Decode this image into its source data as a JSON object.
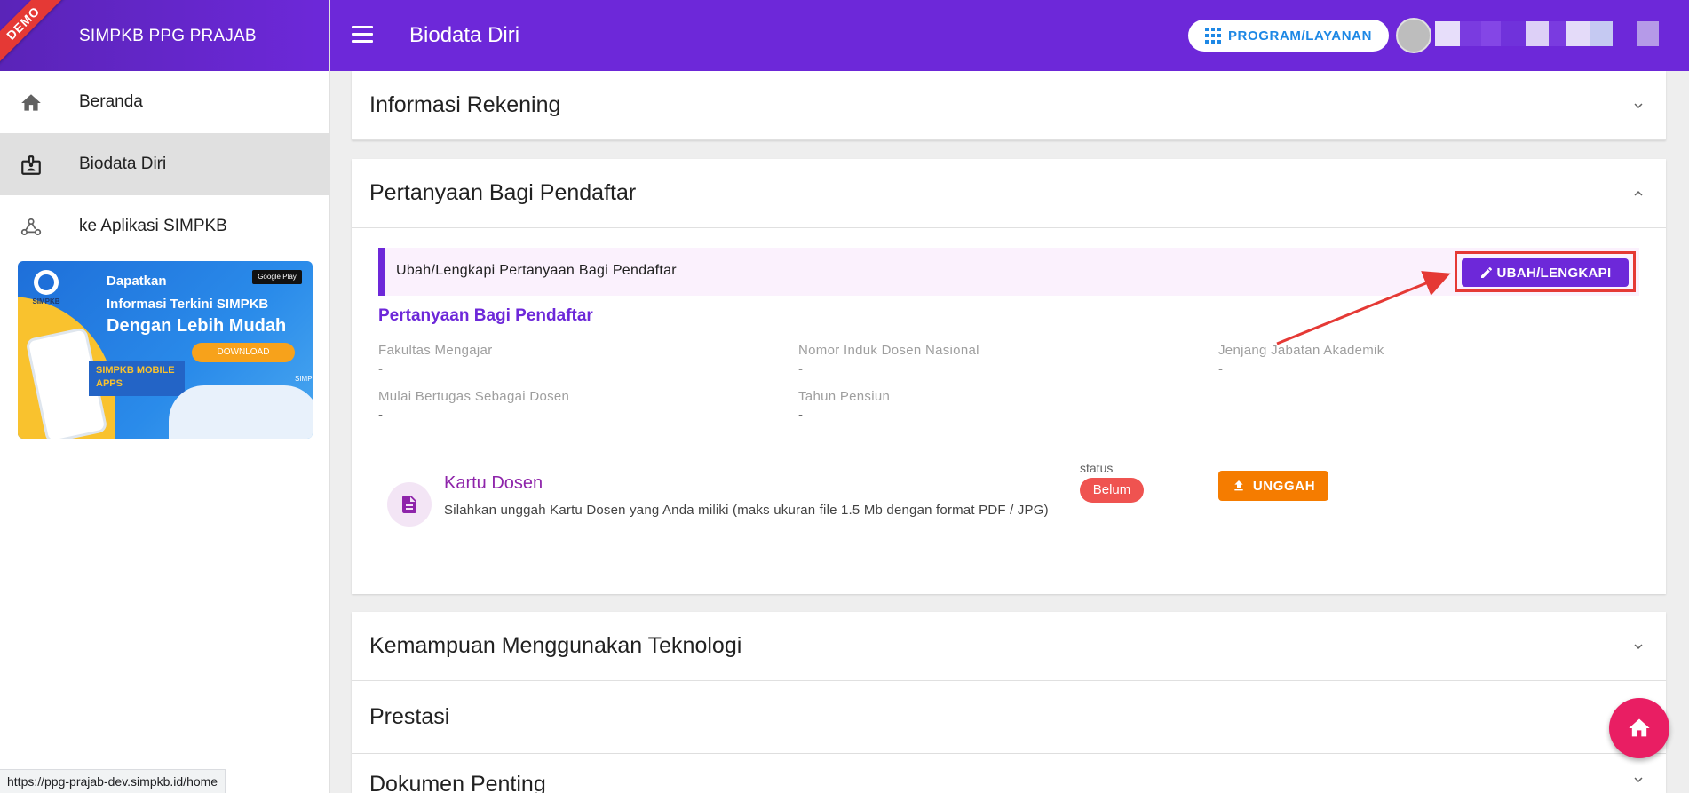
{
  "sidebar": {
    "brand": "SIMPKB PPG PRAJAB",
    "demo_ribbon": "DEMO",
    "items": [
      {
        "label": "Beranda",
        "icon": "home-icon",
        "active": false
      },
      {
        "label": "Biodata Diri",
        "icon": "badge-icon",
        "active": true
      },
      {
        "label": "ke Aplikasi SIMPKB",
        "icon": "webhook-icon",
        "active": false
      }
    ],
    "banner": {
      "logo_text": "SIMPKB",
      "line1": "Dapatkan",
      "line2": "Informasi Terkini SIMPKB",
      "line3": "Dengan Lebih Mudah",
      "store_badge": "Google Play",
      "download_label": "DOWNLOAD",
      "mobile_apps": "SIMPKB MOBILE APPS",
      "corner_logo": "SIMPKB"
    }
  },
  "header": {
    "title": "Biodata Diri",
    "program_button": "PROGRAM/LAYANAN"
  },
  "panels": {
    "rekening": {
      "title": "Informasi Rekening",
      "expanded": false
    },
    "pertanyaan": {
      "title": "Pertanyaan Bagi Pendaftar",
      "expanded": true,
      "notice": "Ubah/Lengkapi Pertanyaan Bagi Pendaftar",
      "edit_button": "UBAH/LENGKAPI",
      "section_title": "Pertanyaan Bagi Pendaftar",
      "fields": [
        {
          "label": "Fakultas Mengajar",
          "value": "-"
        },
        {
          "label": "Nomor Induk Dosen Nasional",
          "value": "-"
        },
        {
          "label": "Jenjang Jabatan Akademik",
          "value": "-"
        },
        {
          "label": "Mulai Bertugas Sebagai Dosen",
          "value": "-"
        },
        {
          "label": "Tahun Pensiun",
          "value": "-"
        }
      ],
      "document": {
        "title": "Kartu Dosen",
        "description": "Silahkan unggah Kartu Dosen yang Anda miliki (maks ukuran file 1.5 Mb dengan format PDF / JPG)",
        "status_label": "status",
        "status_value": "Belum",
        "upload_button": "UNGGAH"
      }
    },
    "teknologi": {
      "title": "Kemampuan Menggunakan Teknologi",
      "expanded": false
    },
    "prestasi": {
      "title": "Prestasi"
    },
    "dokumen": {
      "title": "Dokumen Penting",
      "expanded": false
    }
  },
  "status_bar_url": "https://ppg-prajab-dev.simpkb.id/home",
  "colors": {
    "primary": "#6d28d9",
    "accent_red": "#e53935",
    "status_red": "#ef5350",
    "upload_orange": "#f57c00",
    "fab_pink": "#e91e63",
    "doc_purple": "#8e24aa"
  }
}
